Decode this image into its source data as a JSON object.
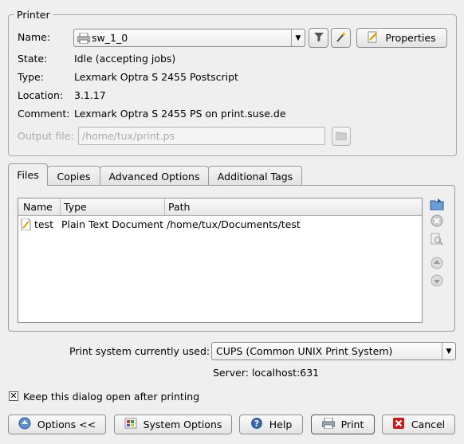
{
  "printer": {
    "group_title": "Printer",
    "name_label": "Name:",
    "name_value": "sw_1_0",
    "properties_label": "Properties",
    "state_label": "State:",
    "state_value": "Idle (accepting jobs)",
    "type_label": "Type:",
    "type_value": "Lexmark Optra S 2455 Postscript",
    "location_label": "Location:",
    "location_value": "3.1.17",
    "comment_label": "Comment:",
    "comment_value": "Lexmark Optra S 2455 PS on print.suse.de",
    "output_label": "Output file:",
    "output_value": "/home/tux/print.ps"
  },
  "tabs": [
    "Files",
    "Copies",
    "Advanced Options",
    "Additional Tags"
  ],
  "files": {
    "columns": [
      "Name",
      "Type",
      "Path"
    ],
    "rows": [
      {
        "name": "test",
        "type": "Plain Text Document",
        "path": "/home/tux/Documents/test"
      }
    ]
  },
  "print_system": {
    "label": "Print system currently used:",
    "value": "CUPS (Common UNIX Print System)",
    "server": "Server: localhost:631"
  },
  "keep_open": {
    "label": "Keep this dialog open after printing",
    "checked": true
  },
  "buttons": {
    "options": "Options <<",
    "system_options": "System Options",
    "help": "Help",
    "print": "Print",
    "cancel": "Cancel"
  },
  "colors": {
    "background": "#efefef",
    "border": "#a9a9a9",
    "cancel_red": "#cc1a1a",
    "help_blue": "#3465a4"
  }
}
